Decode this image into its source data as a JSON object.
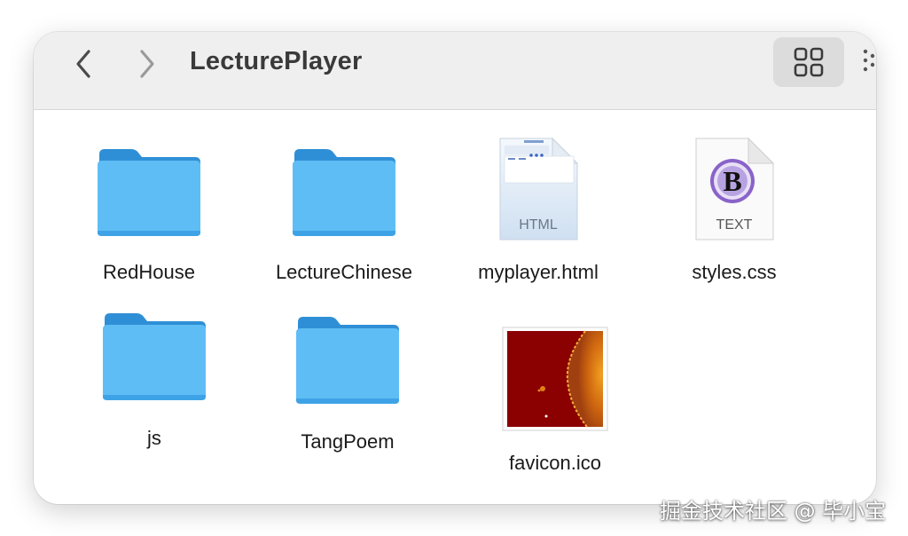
{
  "window": {
    "title": "LecturePlayer"
  },
  "toolbar": {
    "back_icon": "chevron-left-icon",
    "forward_icon": "chevron-right-icon",
    "view_icon": "grid-view-icon",
    "more_icon": "more-dots-icon"
  },
  "items": [
    {
      "name": "RedHouse",
      "kind": "folder"
    },
    {
      "name": "LectureChinese",
      "kind": "folder"
    },
    {
      "name": "myplayer.html",
      "kind": "html-file",
      "badge": "HTML"
    },
    {
      "name": "styles.css",
      "kind": "text-file",
      "badge": "TEXT",
      "glyph": "B"
    },
    {
      "name": "js",
      "kind": "folder"
    },
    {
      "name": "TangPoem",
      "kind": "folder"
    },
    {
      "name": "favicon.ico",
      "kind": "image-file"
    }
  ],
  "watermark": "掘金技术社区 @ 毕小宝",
  "colors": {
    "folder_front": "#5fbdf5",
    "folder_back": "#2f8fd6",
    "toolbar_bg": "#efefef",
    "view_button_bg": "#dcdcdc"
  }
}
